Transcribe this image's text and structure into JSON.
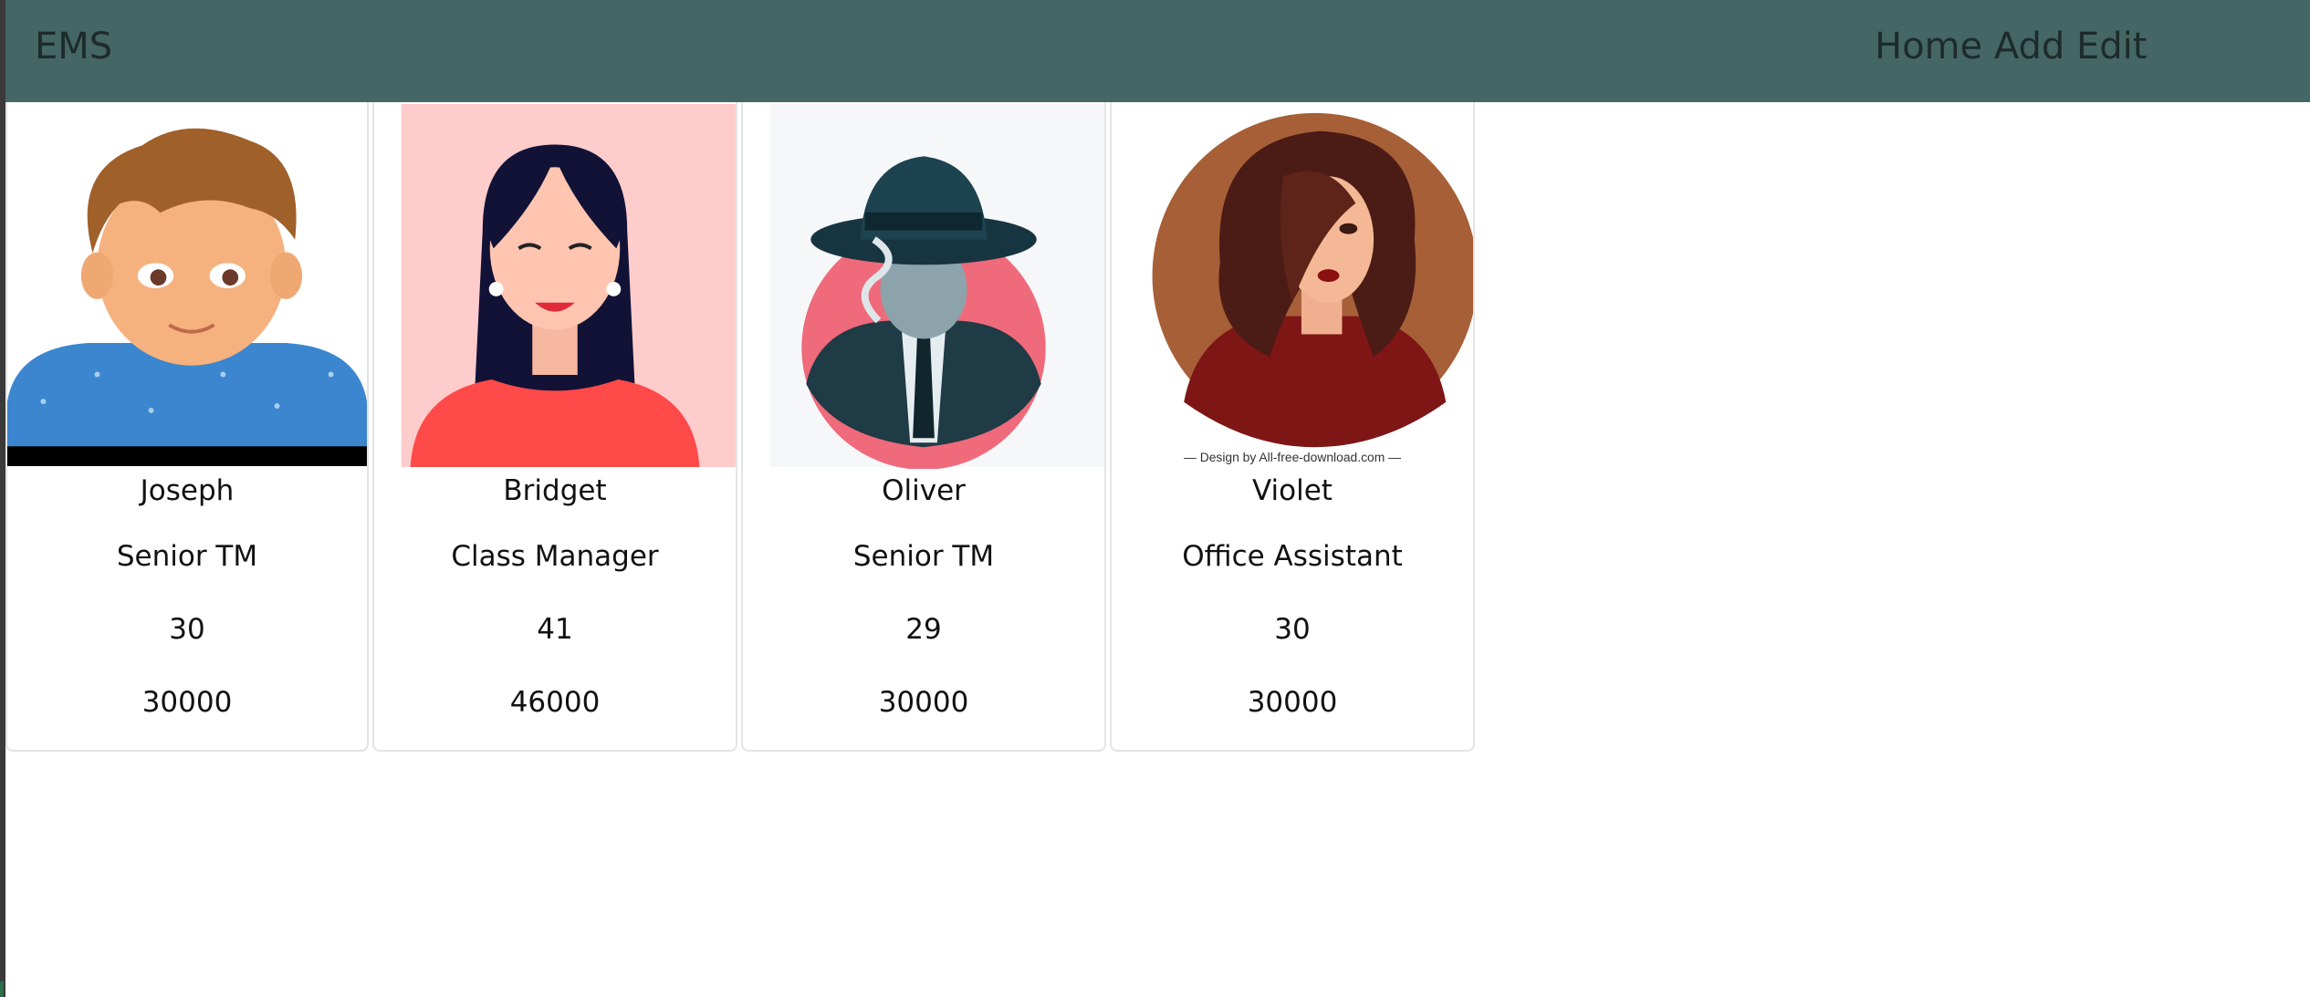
{
  "app": {
    "brand": "EMS"
  },
  "nav": {
    "links": [
      "Home",
      "Add",
      "Edit"
    ]
  },
  "employees": [
    {
      "name": "Joseph",
      "role": "Senior TM",
      "age": "30",
      "salary": "30000",
      "avatar": "boy-avatar-icon"
    },
    {
      "name": "Bridget",
      "role": "Class Manager",
      "age": "41",
      "salary": "46000",
      "avatar": "woman-avatar-icon"
    },
    {
      "name": "Oliver",
      "role": "Senior TM",
      "age": "29",
      "salary": "30000",
      "avatar": "detective-avatar-icon"
    },
    {
      "name": "Violet",
      "role": "Office Assistant",
      "age": "30",
      "salary": "30000",
      "avatar": "curly-woman-avatar-icon",
      "credit": "Design by All-free-download.com"
    }
  ],
  "colors": {
    "navbar": "#446665",
    "card_border": "#e4e4e4"
  }
}
